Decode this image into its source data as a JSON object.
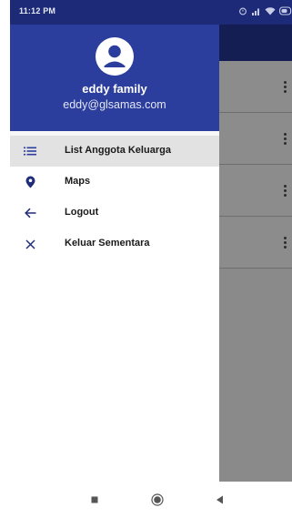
{
  "status_bar": {
    "time": "11:12 PM",
    "icons": [
      "alarm-icon",
      "signal-icon",
      "wifi-icon",
      "battery-icon"
    ]
  },
  "drawer": {
    "header": {
      "avatar_icon": "account-circle-icon",
      "user_name": "eddy family",
      "user_email": "eddy@glsamas.com"
    },
    "items": [
      {
        "label": "List Anggota Keluarga",
        "icon": "list-icon",
        "active": true
      },
      {
        "label": "Maps",
        "icon": "map-pin-icon",
        "active": false
      },
      {
        "label": "Logout",
        "icon": "arrow-left-icon",
        "active": false
      },
      {
        "label": "Keluar Sementara",
        "icon": "close-icon",
        "active": false
      }
    ]
  },
  "background_list": {
    "row_count": 4,
    "row_icon": "more-vert-icon"
  },
  "nav_bar": {
    "icons": [
      "recents-icon",
      "home-icon",
      "back-icon"
    ]
  },
  "colors": {
    "status_bar": "#1c2a78",
    "drawer_header": "#2c3e9d",
    "toolbar": "#141e52",
    "scrim": "#8a8a8a",
    "active_item": "#e2e2e2"
  }
}
